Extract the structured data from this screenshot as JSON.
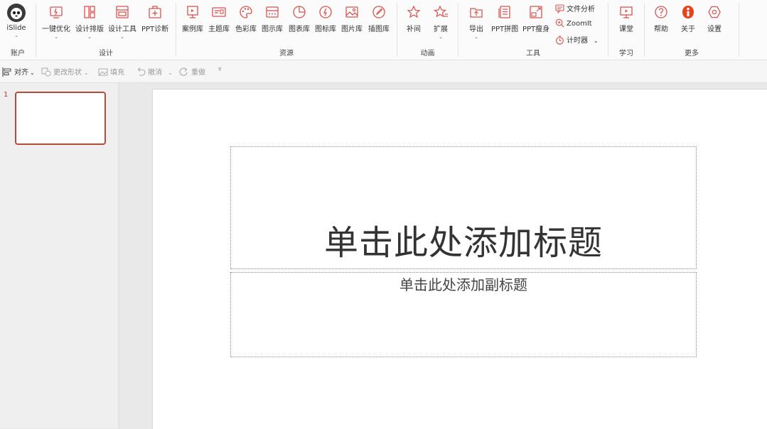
{
  "ribbon": {
    "account": {
      "label": "账户",
      "islide": "iSlide"
    },
    "design": {
      "label": "设计",
      "buttons": [
        "一键优化",
        "设计排版",
        "设计工具",
        "PPT诊断"
      ]
    },
    "resources": {
      "label": "资源",
      "buttons": [
        "案例库",
        "主题库",
        "色彩库",
        "图示库",
        "图表库",
        "图标库",
        "图片库",
        "插图库"
      ]
    },
    "animation": {
      "label": "动画",
      "buttons": [
        "补间",
        "扩展"
      ]
    },
    "tools": {
      "label": "工具",
      "buttons": [
        "导出",
        "PPT拼图",
        "PPT瘦身"
      ],
      "small": [
        "文件分析",
        "ZoomIt",
        "计时器"
      ]
    },
    "learn": {
      "label": "学习",
      "buttons": [
        "课堂"
      ]
    },
    "more": {
      "label": "更多",
      "buttons": [
        "帮助",
        "关于",
        "设置"
      ]
    }
  },
  "toolbar": {
    "align": "对齐",
    "change_shape": "更改形状",
    "fill": "填充",
    "undo": "撤消",
    "redo": "重做"
  },
  "thumbs": {
    "number": "1"
  },
  "slide": {
    "title": "单击此处添加标题",
    "subtitle": "单击此处添加副标题"
  },
  "colors": {
    "accent": "#b94a3a",
    "icon_red": "#d9534f",
    "icon_primary": "#e8431f"
  }
}
